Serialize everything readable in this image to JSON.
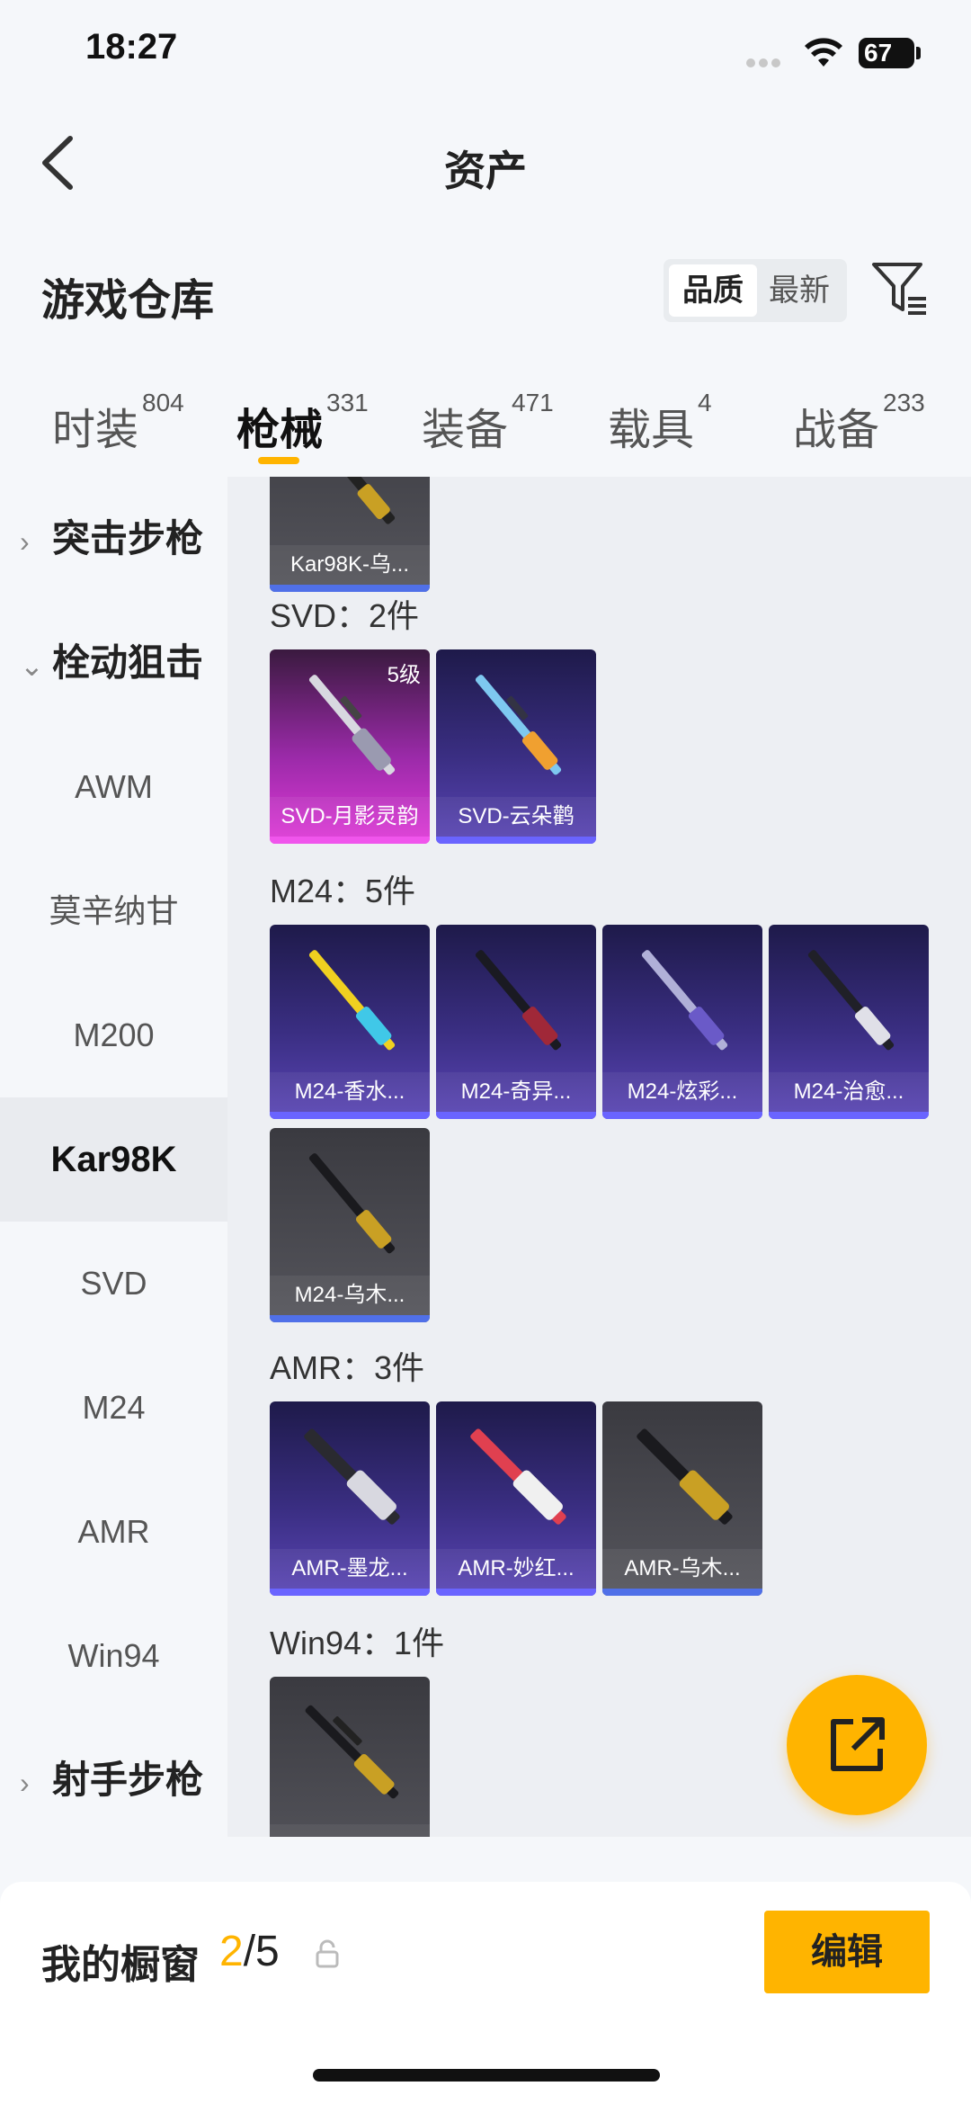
{
  "status_bar": {
    "time": "18:27",
    "battery": "67"
  },
  "nav": {
    "title": "资产"
  },
  "warehouse": {
    "title": "游戏仓库",
    "sort": {
      "quality": "品质",
      "latest": "最新"
    }
  },
  "tabs": [
    {
      "label": "时装",
      "count": "804"
    },
    {
      "label": "枪械",
      "count": "331"
    },
    {
      "label": "装备",
      "count": "471"
    },
    {
      "label": "载具",
      "count": "4"
    },
    {
      "label": "战备",
      "count": "233"
    }
  ],
  "sidebar": {
    "group_assault": "突击步枪",
    "group_bolt": "栓动狙击",
    "items": [
      "AWM",
      "莫辛纳甘",
      "M200",
      "Kar98K",
      "SVD",
      "M24",
      "AMR",
      "Win94"
    ],
    "group_marksman": "射手步枪",
    "active": "Kar98K"
  },
  "content": {
    "top_card": {
      "label": "Kar98K-乌..."
    },
    "sections": [
      {
        "title": "SVD：2件",
        "cards": [
          {
            "label": "SVD-月影灵韵",
            "level": "5级"
          },
          {
            "label": "SVD-云朵鹳"
          }
        ]
      },
      {
        "title": "M24：5件",
        "cards": [
          {
            "label": "M24-香水..."
          },
          {
            "label": "M24-奇异..."
          },
          {
            "label": "M24-炫彩..."
          },
          {
            "label": "M24-治愈..."
          },
          {
            "label": "M24-乌木..."
          }
        ]
      },
      {
        "title": "AMR：3件",
        "cards": [
          {
            "label": "AMR-墨龙..."
          },
          {
            "label": "AMR-妙红..."
          },
          {
            "label": "AMR-乌木..."
          }
        ]
      },
      {
        "title": "Win94：1件",
        "cards": [
          {
            "label": ""
          }
        ]
      }
    ]
  },
  "showcase": {
    "label": "我的橱窗",
    "current": "2",
    "total": "/5",
    "edit": "编辑"
  },
  "colors": {
    "accent": "#ffb400",
    "purple_card": "#3a2e82",
    "gray_card": "#55555c",
    "pink_card": "#e03ad8"
  },
  "icons": [
    "back-arrow-icon",
    "filter-icon",
    "share-export-icon",
    "lock-icon",
    "wifi-icon",
    "battery-icon"
  ]
}
